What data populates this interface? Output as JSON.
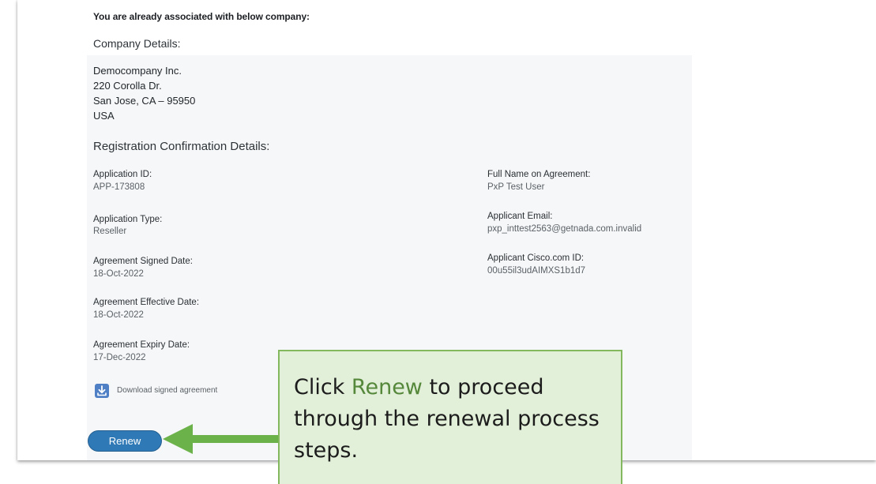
{
  "header": {
    "associated_text": "You are already associated with below company:"
  },
  "company": {
    "section_title": "Company Details:",
    "name": "Democompany Inc.",
    "street": "220 Corolla Dr.",
    "city_state_zip": "San Jose, CA – 95950",
    "country": "USA"
  },
  "registration": {
    "section_title": "Registration Confirmation Details:",
    "left_fields": [
      {
        "label": "Application ID:",
        "value": "APP-173808"
      },
      {
        "label": "Application Type:",
        "value": "Reseller"
      },
      {
        "label": "Agreement Signed Date:",
        "value": "18-Oct-2022"
      },
      {
        "label": "Agreement Effective Date:",
        "value": "18-Oct-2022"
      },
      {
        "label": "Agreement Expiry Date:",
        "value": "17-Dec-2022"
      }
    ],
    "right_fields": [
      {
        "label": "Full Name on Agreement:",
        "value": "PxP Test User"
      },
      {
        "label": "Applicant Email:",
        "value": "pxp_inttest2563@getnada.com.invalid"
      },
      {
        "label": "Applicant Cisco.com ID:",
        "value": "00u55il3udAIMXS1b1d7"
      }
    ]
  },
  "download": {
    "icon": "download-icon",
    "label": "Download signed agreement"
  },
  "actions": {
    "renew_label": "Renew"
  },
  "callout": {
    "before": "Click ",
    "highlight": "Renew",
    "after": " to proceed through the renewal process steps.",
    "highlight_color": "#55883a",
    "background": "#e2efd9",
    "border": "#84b85e",
    "arrow_color": "#6bb24a"
  }
}
